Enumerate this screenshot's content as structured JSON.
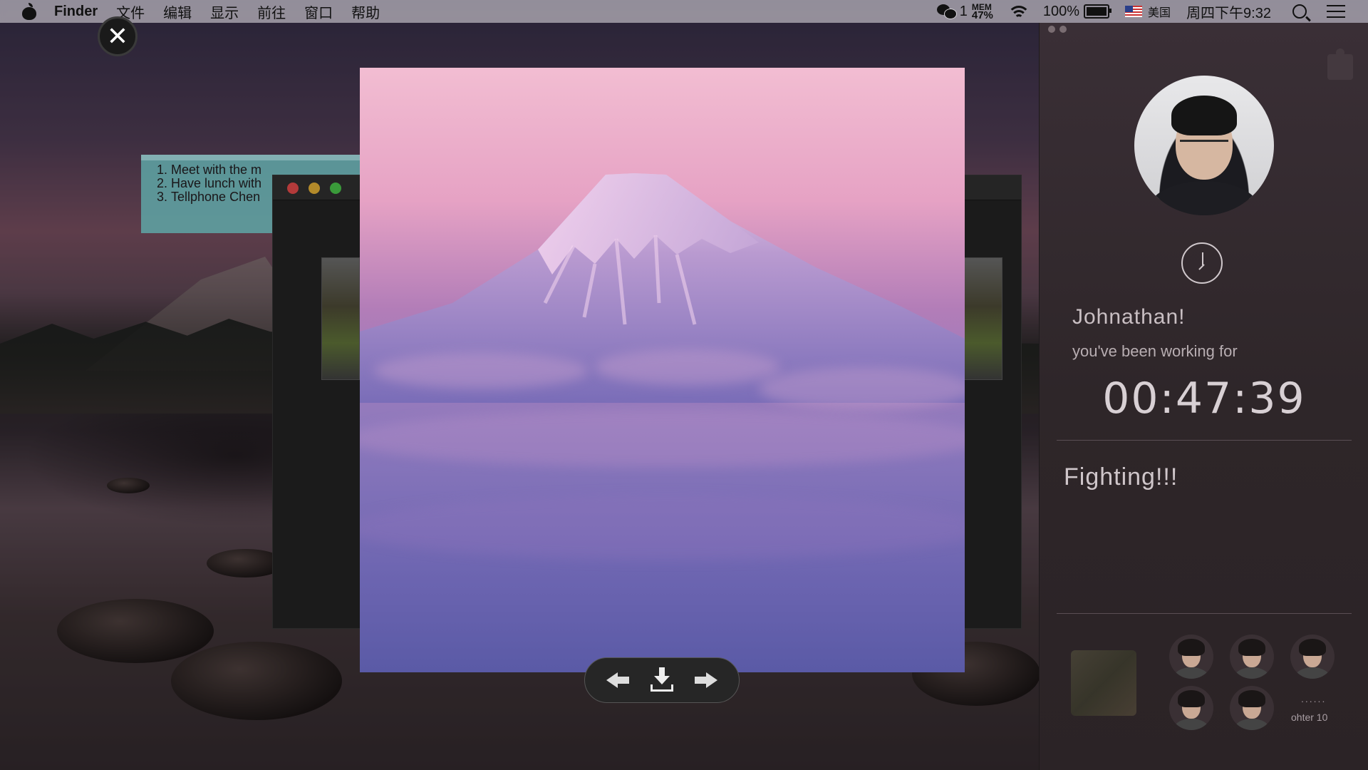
{
  "menubar": {
    "app_name": "Finder",
    "items": [
      "文件",
      "编辑",
      "显示",
      "前往",
      "窗口",
      "帮助"
    ],
    "wechat_count": "1",
    "mem_label": "MEM",
    "mem_value": "47%",
    "battery_pct": "100%",
    "input_source": "美国",
    "datetime": "周四下午9:32"
  },
  "sticky_note": {
    "items": [
      "Meet with the m",
      "Have lunch with",
      "Tellphone Chen"
    ]
  },
  "viewer": {
    "close_icon": "✕",
    "controls": [
      "arrow-left-icon",
      "download-icon",
      "arrow-right-icon"
    ]
  },
  "panel": {
    "greeting_name": "Johnathan!",
    "greeting_sub": "you've been working for",
    "elapsed_time": "00:47:39",
    "motto": "Fighting!!!",
    "more_dots": "......",
    "more_label": "ohter 10"
  },
  "colors": {
    "sky_top": "#f2bdd2",
    "sky_bottom": "#5a5aa6",
    "panel_bg": "#2e2629"
  }
}
